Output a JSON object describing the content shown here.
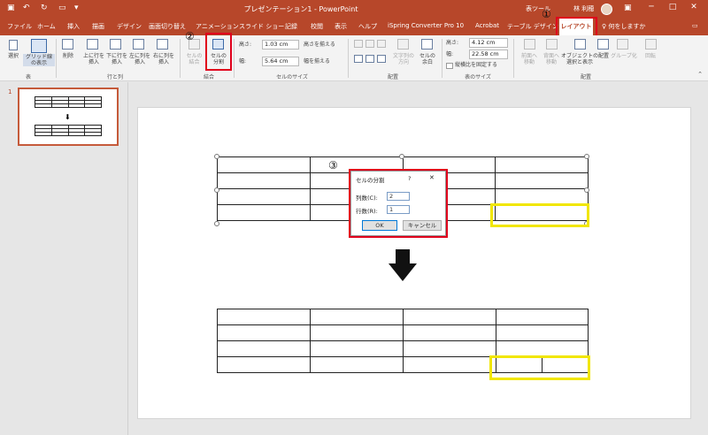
{
  "window": {
    "title": "プレゼンテーション1  -  PowerPoint",
    "table_tools": "表ツール",
    "user": "林 利穂",
    "minimize": "─",
    "restore": "□",
    "close": "✕"
  },
  "tabs": [
    "ファイル",
    "ホーム",
    "挿入",
    "描画",
    "デザイン",
    "画面切り替え",
    "アニメーション",
    "スライド ショー",
    "記録",
    "校閲",
    "表示",
    "ヘルプ",
    "iSpring Converter Pro 10",
    "Acrobat",
    "テーブル デザイン"
  ],
  "active_tab": "レイアウト",
  "tell_me": "何をしますか",
  "ribbon": {
    "select": "選択",
    "gridlines": "グリッド線\nの表示",
    "group_table": "表",
    "delete": "削除",
    "insert_above": "上に行を\n挿入",
    "insert_below": "下に行を\n挿入",
    "insert_left": "左に列を\n挿入",
    "insert_right": "右に列を\n挿入",
    "group_rowscols": "行と列",
    "merge_cells": "セルの\n結合",
    "split_cells": "セルの\n分割",
    "group_merge": "結合",
    "height_label": "高さ:",
    "height_value": "1.03 cm",
    "width_label": "幅:",
    "width_value": "5.64 cm",
    "distribute_rows": "高さを揃える",
    "distribute_cols": "幅を揃える",
    "group_cellsize": "セルのサイズ",
    "text_direction": "文字列の\n方向",
    "cell_margins": "セルの\n余白",
    "group_alignment": "配置",
    "table_height_label": "高さ:",
    "table_height_value": "4.12 cm",
    "table_width_label": "幅:",
    "table_width_value": "22.58 cm",
    "lock_aspect": "縦横比を固定する",
    "group_tablesize": "表のサイズ",
    "bring_forward": "前面へ\n移動",
    "send_backward": "背面へ\n移動",
    "selection_pane": "オブジェクトの\n選択と表示",
    "align": "配置",
    "group": "グループ化",
    "rotate": "回転",
    "group_arrange": "配置"
  },
  "slide_number": "1",
  "dialog": {
    "title": "セルの分割",
    "help": "?",
    "close": "✕",
    "cols_label": "列数(C):",
    "cols_value": "2",
    "rows_label": "行数(R):",
    "rows_value": "1",
    "ok": "OK",
    "cancel": "キャンセル"
  },
  "callouts": {
    "step1": "①",
    "step2": "②",
    "step3": "③"
  },
  "colors": {
    "accent": "#b7472a",
    "highlight_red": "#e0001b",
    "highlight_yellow": "#f1e600"
  }
}
